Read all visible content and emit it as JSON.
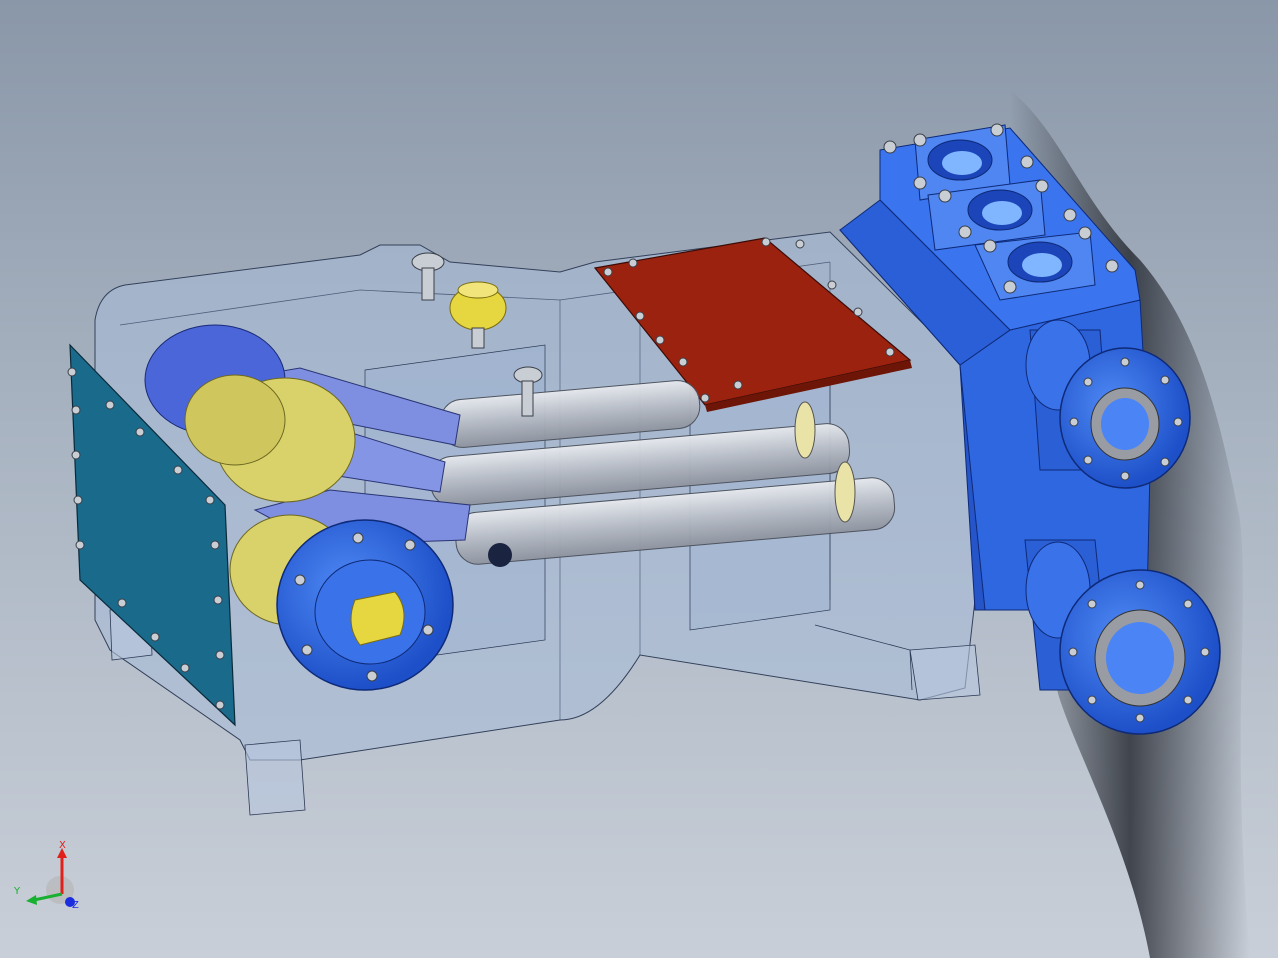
{
  "view": {
    "colors": {
      "background_top": "#8a97a8",
      "background_bottom": "#c9cfd8",
      "housing": "#9fb3d6",
      "fluid_end": "#2f67e0",
      "cover_plate": "#9c2210",
      "side_cover": "#1a6a8c",
      "crankshaft": "#d9d26a",
      "connecting_rod": "#7e8ee0",
      "plunger": "#c9ced6"
    }
  },
  "triad": {
    "x_label": "X",
    "y_label": "Y",
    "z_label": "Z",
    "x_color": "#e0201a",
    "y_color": "#18b030",
    "z_color": "#1a2ee0"
  }
}
